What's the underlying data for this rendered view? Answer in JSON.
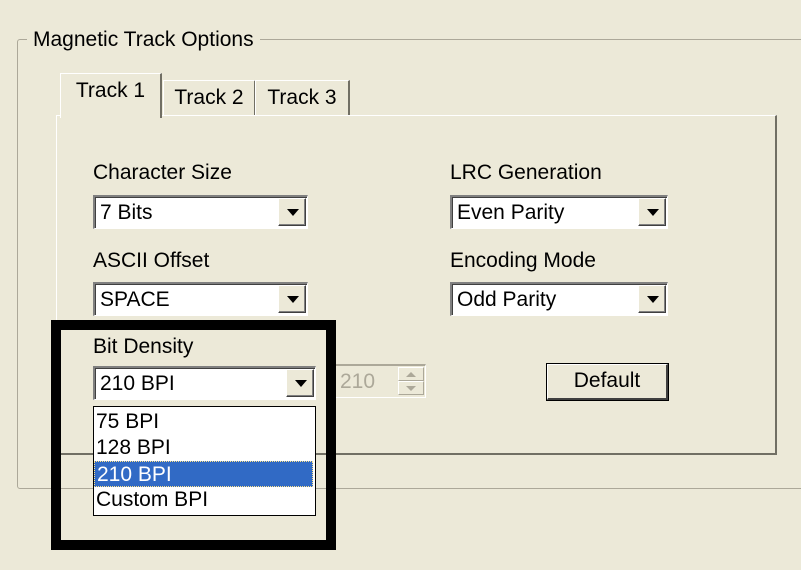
{
  "group": {
    "title": "Magnetic Track Options"
  },
  "tabs": [
    {
      "label": "Track 1",
      "active": true
    },
    {
      "label": "Track 2",
      "active": false
    },
    {
      "label": "Track 3",
      "active": false
    }
  ],
  "fields": {
    "character_size": {
      "label": "Character Size",
      "value": "7 Bits"
    },
    "lrc_generation": {
      "label": "LRC Generation",
      "value": "Even Parity"
    },
    "ascii_offset": {
      "label": "ASCII Offset",
      "value": "SPACE"
    },
    "encoding_mode": {
      "label": "Encoding Mode",
      "value": "Odd Parity"
    },
    "bit_density": {
      "label": "Bit Density",
      "value": "210 BPI",
      "options": [
        "75 BPI",
        "128 BPI",
        "210 BPI",
        "Custom BPI"
      ],
      "selected_index": 2
    },
    "custom_bpi_spin": {
      "value": "210",
      "enabled": false
    }
  },
  "buttons": {
    "default_label": "Default"
  },
  "colors": {
    "window": "#ECE9D8",
    "selection": "#316AC5",
    "highlight_frame": "#000000"
  }
}
